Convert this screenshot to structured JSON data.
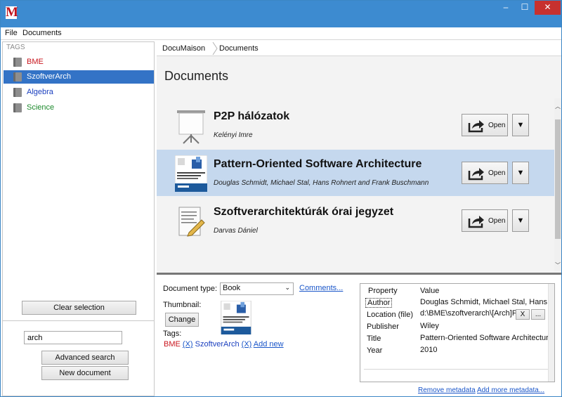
{
  "app": {
    "logo": "M"
  },
  "window_controls": {
    "minimize": "–",
    "maximize": "☐",
    "close": "✕"
  },
  "menu": {
    "items": [
      "File",
      "Documents"
    ]
  },
  "sidebar": {
    "header": "TAGS",
    "tags": [
      {
        "label": "BME",
        "color": "#c9161e",
        "selected": false
      },
      {
        "label": "SzoftverArch",
        "color": "#1a3fbf",
        "selected": true
      },
      {
        "label": "Algebra",
        "color": "#1a3fbf",
        "selected": false
      },
      {
        "label": "Science",
        "color": "#1d8a2d",
        "selected": false
      }
    ],
    "clear_selection": "Clear selection",
    "search_value": "arch",
    "advanced_search": "Advanced search",
    "new_document": "New document"
  },
  "breadcrumb": {
    "items": [
      "DocuMaison",
      "Documents"
    ]
  },
  "main": {
    "title": "Documents",
    "documents": [
      {
        "title": "P2P hálózatok",
        "authors": "Kelényi Imre",
        "icon": "presentation-icon",
        "selected": false
      },
      {
        "title": "Pattern-Oriented Software Architecture",
        "authors": "Douglas Schmidt, Michael Stal, Hans Rohnert and Frank Buschmann",
        "icon": "book-cover-thumbnail",
        "selected": true
      },
      {
        "title": "Szoftverarchitektúrák órai jegyzet",
        "authors": "Darvas Dániel",
        "icon": "notes-document-icon",
        "selected": false
      }
    ],
    "open_label": "Open",
    "dropdown_glyph": "▼"
  },
  "details": {
    "document_type_label": "Document type:",
    "document_type_value": "Book",
    "comments_link": "Comments...",
    "thumbnail_label": "Thumbnail:",
    "change_button": "Change",
    "tags_label": "Tags:",
    "tags": [
      {
        "label": "BME",
        "remove": "(X)"
      },
      {
        "label": "SzoftverArch",
        "remove": "(X)"
      }
    ],
    "add_new": "Add new",
    "metadata": {
      "header_property": "Property",
      "header_value": "Value",
      "rows": [
        {
          "key": "Author",
          "value": "Douglas Schmidt, Michael Stal, Hans Ro"
        },
        {
          "key": "Location (file)",
          "value": "d:\\BME\\szoftverarch\\[Arch]Pa"
        },
        {
          "key": "Publisher",
          "value": "Wiley"
        },
        {
          "key": "Title",
          "value": "Pattern-Oriented Software Architecture"
        },
        {
          "key": "Year",
          "value": "2010"
        }
      ],
      "location_clear": "X",
      "location_browse": "..."
    },
    "remove_metadata": "Remove metadata",
    "add_more_metadata": "Add more metadata..."
  }
}
